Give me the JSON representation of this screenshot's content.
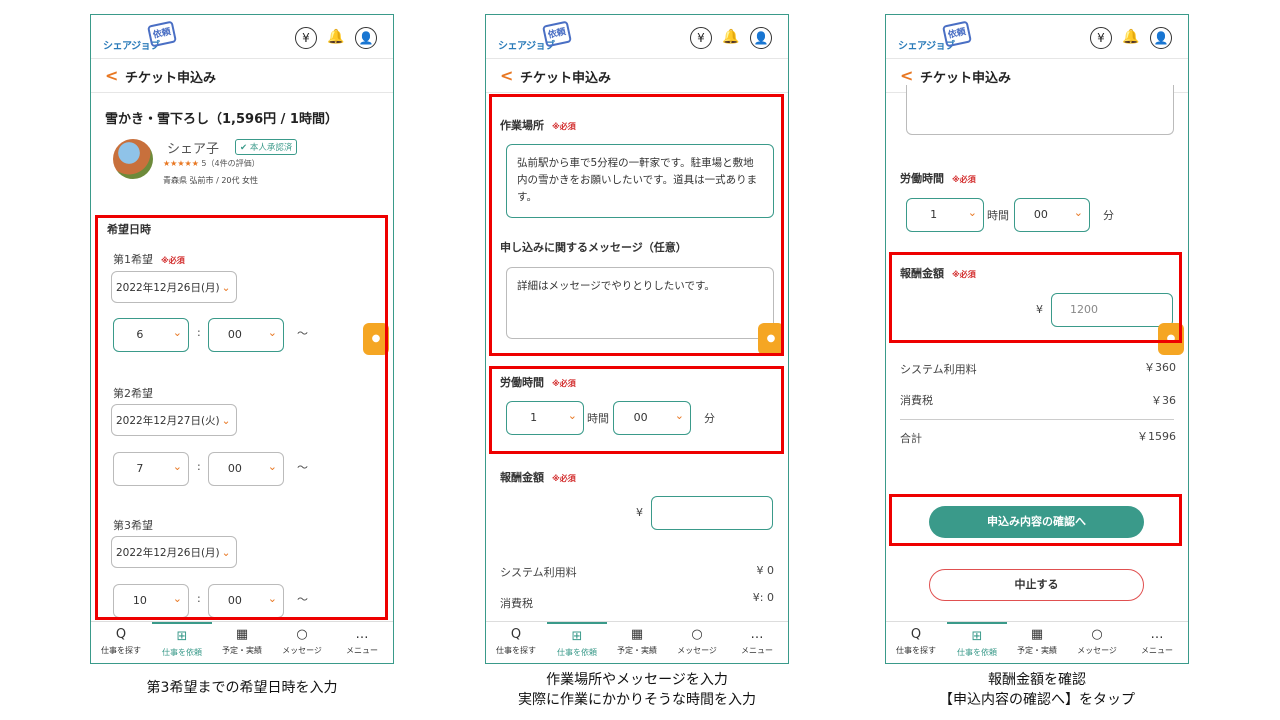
{
  "header": {
    "logo_text": "シェアジョブ",
    "logo_mark": "依頼",
    "icon_yen": "¥",
    "icon_bell": "🔔",
    "icon_user": "👤"
  },
  "title_bar": {
    "back": "<",
    "title": "チケット申込み"
  },
  "tabs": [
    {
      "icon": "Q",
      "label": "仕事を探す"
    },
    {
      "icon": "⊞",
      "label": "仕事を依頼"
    },
    {
      "icon": "▦",
      "label": "予定・実績"
    },
    {
      "icon": "○",
      "label": "メッセージ"
    },
    {
      "icon": "…",
      "label": "メニュー"
    }
  ],
  "screen1": {
    "job_title": "雪かき・雪下ろし（1,596円 / 1時間）",
    "profile": {
      "name": "シェア子",
      "badge": "本人承認済",
      "stars": "★★★★★",
      "rating": "5（4件の評価）",
      "location": "青森県 弘前市 / 20代 女性"
    },
    "section_label": "希望日時",
    "required": "※必須",
    "choices": [
      {
        "label": "第1希望",
        "date": "2022年12月26日(月)",
        "hour": "6",
        "minute": "00"
      },
      {
        "label": "第2希望",
        "date": "2022年12月27日(火)",
        "hour": "7",
        "minute": "00"
      },
      {
        "label": "第3希望",
        "date": "2022年12月26日(月)",
        "hour": "10",
        "minute": "00"
      }
    ],
    "colon": ":",
    "tilde": "〜",
    "caption": "第3希望までの希望日時を入力"
  },
  "screen2": {
    "workplace_label": "作業場所",
    "required": "※必須",
    "workplace_text": "弘前駅から車で5分程の一軒家です。駐車場と敷地内の雪かきをお願いしたいです。道具は一式あります。",
    "message_label": "申し込みに関するメッセージ（任意）",
    "message_text": "詳細はメッセージでやりとりしたいです。",
    "hours_label": "労働時間",
    "hours_value": "1",
    "hours_unit": "時間",
    "minutes_value": "00",
    "minutes_unit": "分",
    "reward_label": "報酬金額",
    "yen": "¥",
    "system_fee_label": "システム利用料",
    "system_fee_value": "¥ 0",
    "tax_label": "消費税",
    "tax_value": "¥: 0",
    "caption_line1": "作業場所やメッセージを入力",
    "caption_line2": "実際に作業にかかりそうな時間を入力"
  },
  "screen3": {
    "hours_label": "労働時間",
    "required": "※必須",
    "hours_value": "1",
    "hours_unit": "時間",
    "minutes_value": "00",
    "minutes_unit": "分",
    "reward_label": "報酬金額",
    "yen": "¥",
    "reward_value": "1200",
    "system_fee_label": "システム利用料",
    "system_fee_value": "￥360",
    "tax_label": "消費税",
    "tax_value": "￥36",
    "total_label": "合計",
    "total_value": "￥1596",
    "confirm_button": "申込み内容の確認へ",
    "cancel_button": "中止する",
    "caption_line1": "報酬金額を確認",
    "caption_line2": "【申込内容の確認へ】をタップ"
  },
  "colors": {
    "accent": "#3a9a8a",
    "orange": "#e87722",
    "highlight": "#e00000",
    "required": "#d32f2f"
  }
}
